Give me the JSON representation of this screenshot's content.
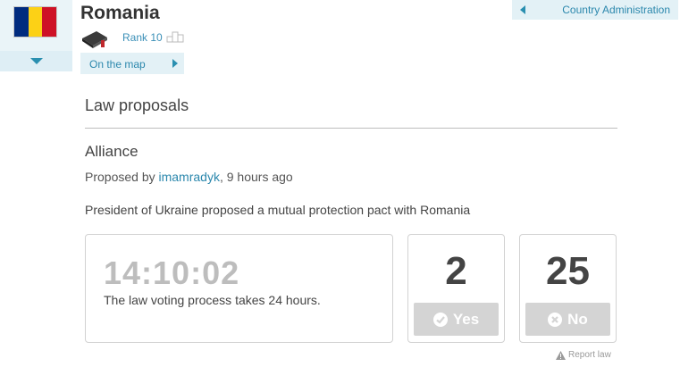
{
  "country": {
    "name": "Romania",
    "flag_colors": [
      "#002B7F",
      "#FCD116",
      "#CE1126"
    ],
    "rank_label": "Rank 10",
    "map_link": "On the map",
    "admin_link": "Country Administration"
  },
  "section": {
    "title": "Law proposals"
  },
  "law": {
    "title": "Alliance",
    "proposed_prefix": "Proposed by ",
    "proposer": "imamradyk",
    "proposed_suffix": ", 9 hours ago",
    "description": "President of Ukraine proposed a mutual protection pact with Romania",
    "timer": "14:10:02",
    "timer_note": "The law voting process takes 24 hours.",
    "yes_count": "2",
    "yes_label": "Yes",
    "no_count": "25",
    "no_label": "No",
    "report_label": "Report law"
  },
  "icons": [
    "chevron-down-icon",
    "book-icon",
    "rank-icon",
    "chevron-right-icon",
    "chevron-left-icon",
    "check-circle-icon",
    "x-circle-icon",
    "warning-icon"
  ]
}
